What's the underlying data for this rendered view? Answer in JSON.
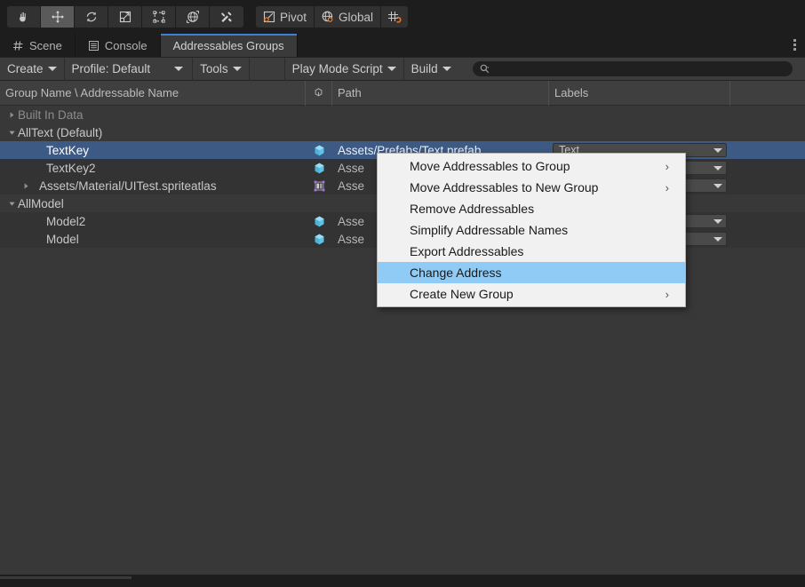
{
  "toolbar": {
    "tools": [
      {
        "name": "hand-tool",
        "active": false
      },
      {
        "name": "move-tool",
        "active": true
      },
      {
        "name": "rotate-tool",
        "active": false
      },
      {
        "name": "scale-tool",
        "active": false
      },
      {
        "name": "rect-transform-tool",
        "active": false
      },
      {
        "name": "transform-tool",
        "active": false
      },
      {
        "name": "custom-editor-tool",
        "active": false
      }
    ],
    "pivot_label": "Pivot",
    "global_label": "Global",
    "snap_label": ""
  },
  "tabs": [
    {
      "label": "Scene",
      "icon": "grid-icon",
      "active": false
    },
    {
      "label": "Console",
      "icon": "console-icon",
      "active": false
    },
    {
      "label": "Addressables Groups",
      "icon": "",
      "active": true
    }
  ],
  "addressables_toolbar": {
    "create_label": "Create",
    "profile_label": "Profile: Default",
    "tools_label": "Tools",
    "play_mode_script_label": "Play Mode Script",
    "build_label": "Build",
    "search_value": "",
    "search_placeholder": ""
  },
  "columns": [
    {
      "label": "Group Name \\ Addressable Name"
    },
    {
      "label": ""
    },
    {
      "label": "Path"
    },
    {
      "label": "Labels"
    },
    {
      "label": ""
    }
  ],
  "tree": [
    {
      "name": "Built In Data",
      "type": "group",
      "expanded": false,
      "twisty": "collapsed",
      "dim": true,
      "path": "",
      "label": "",
      "icon": "",
      "selected": false,
      "indent": 1
    },
    {
      "name": "AllText (Default)",
      "type": "group",
      "expanded": true,
      "twisty": "expanded",
      "dim": false,
      "path": "",
      "label": "",
      "icon": "",
      "selected": false,
      "indent": 1
    },
    {
      "name": "TextKey",
      "type": "asset",
      "twisty": "none",
      "path": "Assets/Prefabs/Text.prefab",
      "label": "Text",
      "icon": "prefab-icon",
      "selected": true,
      "indent": 3
    },
    {
      "name": "TextKey2",
      "type": "asset",
      "twisty": "none",
      "path": "Asse",
      "label": "",
      "icon": "prefab-icon",
      "selected": false,
      "indent": 3
    },
    {
      "name": "Assets/Material/UITest.spriteatlas",
      "type": "asset",
      "twisty": "collapsed",
      "path": "Asse",
      "label": "",
      "icon": "spriteatlas-icon",
      "selected": false,
      "indent": 2
    },
    {
      "name": "AllModel",
      "type": "group",
      "expanded": true,
      "twisty": "expanded",
      "dim": false,
      "path": "",
      "label": "",
      "icon": "",
      "selected": false,
      "indent": 1
    },
    {
      "name": "Model2",
      "type": "asset",
      "twisty": "none",
      "path": "Asse",
      "label": "",
      "icon": "prefab-icon",
      "selected": false,
      "indent": 3
    },
    {
      "name": "Model",
      "type": "asset",
      "twisty": "none",
      "path": "Asse",
      "label": "",
      "icon": "prefab-icon",
      "selected": false,
      "indent": 3
    }
  ],
  "context_menu": {
    "items": [
      {
        "label": "Move Addressables to Group",
        "submenu": true,
        "highlighted": false
      },
      {
        "label": "Move Addressables to New Group",
        "submenu": true,
        "highlighted": false
      },
      {
        "label": "Remove Addressables",
        "submenu": false,
        "highlighted": false
      },
      {
        "label": "Simplify Addressable Names",
        "submenu": false,
        "highlighted": false
      },
      {
        "label": "Export Addressables",
        "submenu": false,
        "highlighted": false
      },
      {
        "label": "Change Address",
        "submenu": false,
        "highlighted": true
      },
      {
        "label": "Create New Group",
        "submenu": true,
        "highlighted": false
      }
    ],
    "submenu_glyph": "›"
  },
  "colors": {
    "selection_blue": "#3d5a84",
    "menu_highlight": "#8fcbf5",
    "tab_accent": "#3b82d4",
    "accent_orange": "#e8762c",
    "prefab_blue": "#5fc3e8"
  }
}
